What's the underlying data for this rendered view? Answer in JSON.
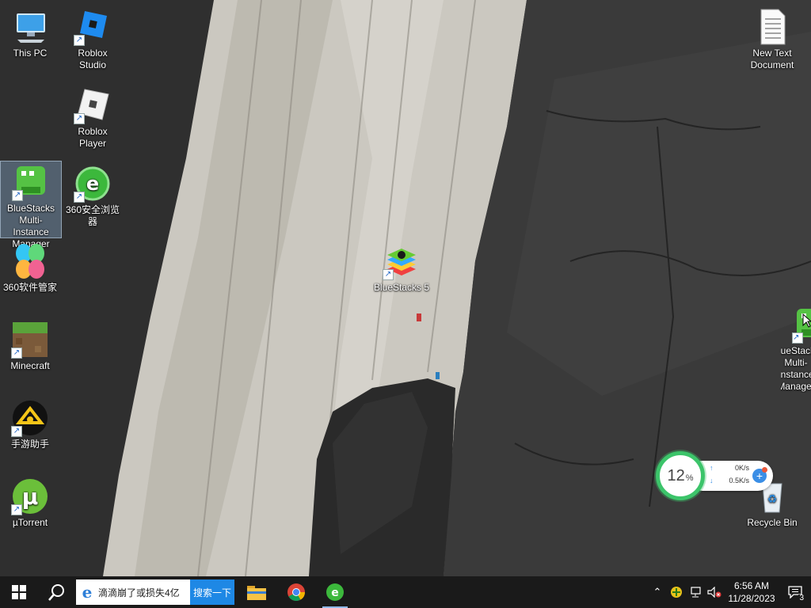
{
  "desktop": {
    "icons": [
      {
        "label": "This PC",
        "icon": "computer-icon"
      },
      {
        "label": "Roblox Studio",
        "icon": "roblox-studio-icon"
      },
      {
        "label": "Roblox Player",
        "icon": "roblox-player-icon"
      },
      {
        "label": "BlueStacks Multi-Instance Manager",
        "icon": "bluestacks-mim-icon"
      },
      {
        "label": "360安全浏览器",
        "icon": "360-browser-icon"
      },
      {
        "label": "360软件管家",
        "icon": "360-software-manager-icon"
      },
      {
        "label": "Minecraft",
        "icon": "minecraft-icon"
      },
      {
        "label": "手游助手",
        "icon": "mobile-game-assistant-icon"
      },
      {
        "label": "µTorrent",
        "icon": "utorrent-icon"
      },
      {
        "label": "BlueStacks 5",
        "icon": "bluestacks-5-icon"
      },
      {
        "label": "New Text Document",
        "icon": "text-document-icon"
      },
      {
        "label": "Recycle Bin",
        "icon": "recycle-bin-icon"
      },
      {
        "label": "BlueStacks Multi-Instance Manager",
        "icon": "bluestacks-mim-icon"
      }
    ]
  },
  "net_widget": {
    "cpu_value": "12",
    "cpu_unit": "%",
    "upload": "0K/s",
    "download": "0.5K/s",
    "upload_arrow": "↑",
    "download_arrow": "↓",
    "plus": "+"
  },
  "taskbar": {
    "search_text": "滴滴崩了或损失4亿",
    "search_button": "搜索一下",
    "ie_glyph": "e",
    "tray_chevron": "⌃",
    "time": "6:56 AM",
    "date": "11/28/2023",
    "notification_count": "3"
  },
  "colors": {
    "taskbar_bg": "#1a1a1a",
    "search_button_bg": "#1e88e5",
    "widget_ring": "#3cc46a"
  }
}
